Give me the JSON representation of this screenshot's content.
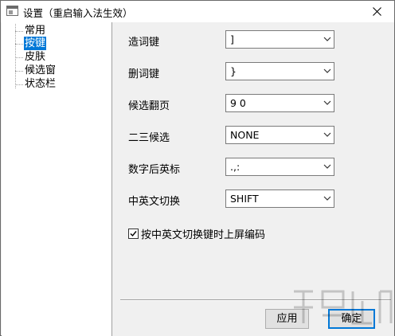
{
  "window": {
    "title": "设置（重启输入法生效）",
    "close_icon": "close-icon"
  },
  "tree": {
    "items": [
      {
        "label": "常用",
        "selected": false
      },
      {
        "label": "按键",
        "selected": true
      },
      {
        "label": "皮肤",
        "selected": false
      },
      {
        "label": "候选窗",
        "selected": false
      },
      {
        "label": "状态栏",
        "selected": false
      }
    ]
  },
  "settings": {
    "rows": [
      {
        "label": "造词键",
        "value": "]"
      },
      {
        "label": "删词键",
        "value": "}"
      },
      {
        "label": "候选翻页",
        "value": "9 0"
      },
      {
        "label": "二三候选",
        "value": "NONE"
      },
      {
        "label": "数字后英标",
        "value": ".,:"
      },
      {
        "label": "中英文切换",
        "value": "SHIFT"
      }
    ],
    "checkbox": {
      "label": "按中英文切换键时上屏编码",
      "checked": true
    }
  },
  "buttons": {
    "apply": "应用",
    "ok": "确定"
  },
  "accent_color": "#0078d7"
}
